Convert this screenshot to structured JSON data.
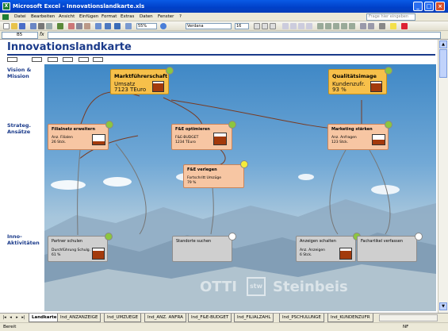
{
  "window": {
    "title": "Microsoft Excel - Innovationslandkarte.xls",
    "app_icon": "excel-icon"
  },
  "menu": {
    "items": [
      "Datei",
      "Bearbeiten",
      "Ansicht",
      "Einfügen",
      "Format",
      "Extras",
      "Daten",
      "Fenster",
      "?"
    ],
    "help_placeholder": "Frage hier eingeben"
  },
  "toolbar": {
    "zoom": "55%",
    "font": "Verdana",
    "font_size": "16"
  },
  "formula_bar": {
    "cell_ref": "B5",
    "fx": "fx"
  },
  "sheet": {
    "title": "Innovationslandkarte",
    "row_labels": {
      "vision": "Vision & Mission",
      "strategy": "Strateg. Ansätze",
      "activities": "Inno-Aktivitäten"
    }
  },
  "map": {
    "vision_boxes": [
      {
        "title": "Marktführerschaft",
        "kpi_lines": [
          "Umsatz",
          "7123 TEuro"
        ],
        "status": "green",
        "fill": 0.85
      },
      {
        "title": "Qualitätsimage",
        "kpi_lines": [
          "Kundenzufr.",
          "93 %"
        ],
        "status": "green",
        "fill": 0.8
      }
    ],
    "strategy_boxes": [
      {
        "title": "Filialnetz erweitern",
        "kpi_lines": [
          "Anz. Filialen",
          "26 Stck."
        ],
        "status": "green",
        "fill": 0.3
      },
      {
        "title": "F&E optimieren",
        "kpi_lines": [
          "F&E-BUDGET",
          "1234 TEuro"
        ],
        "status": "green",
        "fill": 0.75
      },
      {
        "title": "Marketing stärken",
        "kpi_lines": [
          "Anz. Anfragen",
          "123 Stck."
        ],
        "status": "green",
        "fill": 0.5
      },
      {
        "title": "F&E verlegen",
        "kpi_lines": [
          "Fortschritt Umzüge",
          "79 %"
        ],
        "status": "yellow",
        "fill": 0.8
      }
    ],
    "activity_boxes": [
      {
        "title": "Partner schulen",
        "kpi_lines": [
          "Durchführung Schulg.",
          "61 %"
        ],
        "status": "green",
        "fill": 0.8
      },
      {
        "title": "Standorte suchen",
        "kpi_lines": [],
        "status": "white",
        "fill": 0
      },
      {
        "title": "Anzeigen schalten",
        "kpi_lines": [
          "Anz. Anzeigen",
          "6 Stck."
        ],
        "status": "green",
        "fill": 0.75
      },
      {
        "title": "Fachartikel verfassen",
        "kpi_lines": [],
        "status": "white",
        "fill": 0
      }
    ],
    "watermark": {
      "left": "OTTI",
      "mark": "stw",
      "right": "Steinbeis"
    }
  },
  "colors": {
    "green": "#8cc63f",
    "yellow": "#f5ec3a",
    "white": "#ffffff",
    "kpi_fill": "#a33a0c",
    "title_blue": "#1a3a8a"
  },
  "sheet_tabs": [
    "Landkarte",
    "Ind_ANZANZEIGE",
    "Ind_UMZUEGE",
    "Ind_ANZ. ANFRA",
    "Ind_F&E-BUDGET",
    "Ind_FILIALZAHL",
    "Ind_PSCHULUNGE",
    "Ind_KUNDENZUFR"
  ],
  "status_bar": {
    "left": "Bereit",
    "right": "NF"
  }
}
